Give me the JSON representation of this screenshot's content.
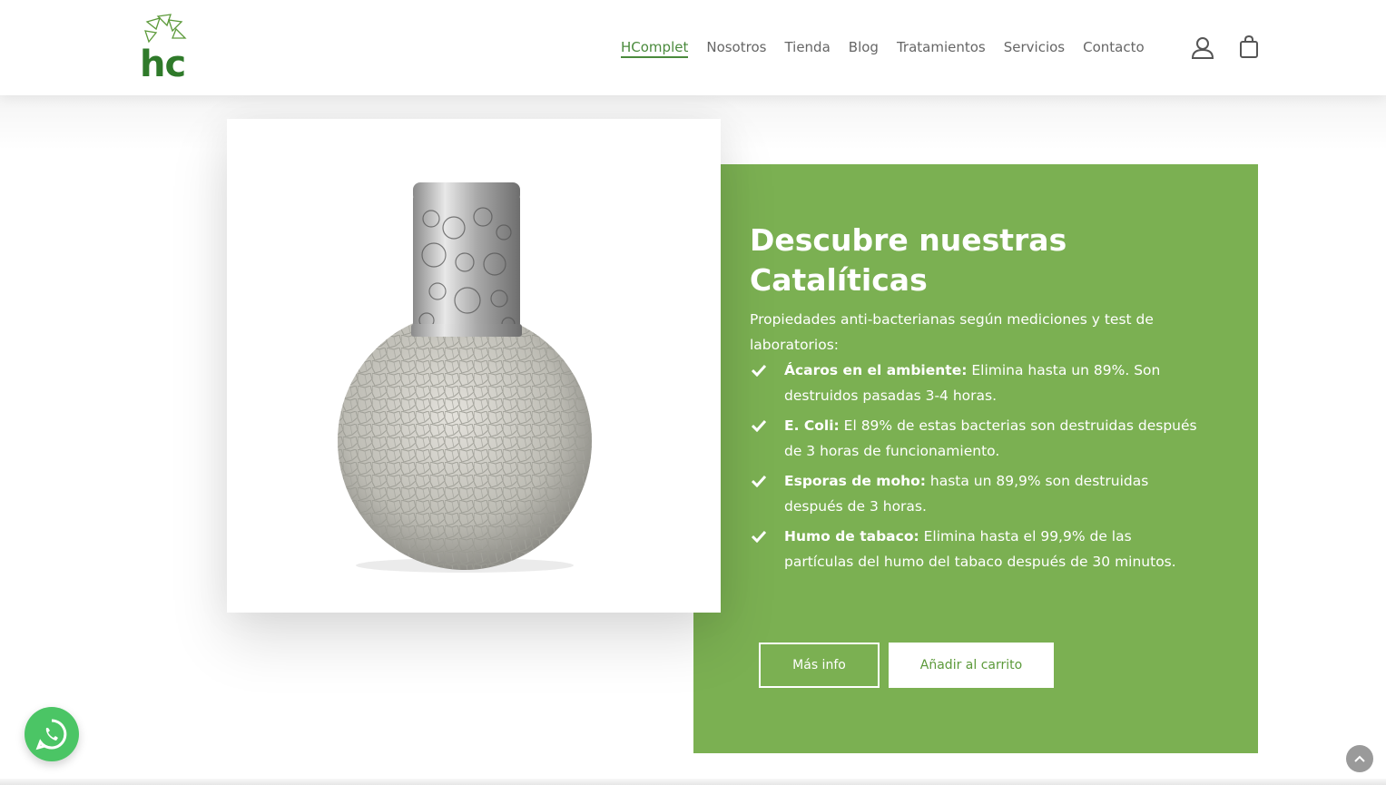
{
  "header": {
    "logo_text": "hc",
    "nav": [
      {
        "label": "HComplet",
        "active": true
      },
      {
        "label": "Nosotros"
      },
      {
        "label": "Tienda"
      },
      {
        "label": "Blog"
      },
      {
        "label": "Tratamientos"
      },
      {
        "label": "Servicios"
      },
      {
        "label": "Contacto"
      }
    ],
    "icons": [
      "user-account-icon",
      "shopping-bag-icon"
    ]
  },
  "product": {
    "image_alt": "lámpara catalítica",
    "title": "Descubre nuestras Catalíticas",
    "intro": "Propiedades anti-bacterianas según mediciones y test de laboratorios:",
    "benefits": [
      {
        "bold": "Ácaros en el ambiente:",
        "text": " Elimina hasta un 89%. Son destruidos pasadas 3-4 horas."
      },
      {
        "bold": "E. Coli:",
        "text": " El 89% de estas bacterias son destruidas después de 3 horas de funcionamiento."
      },
      {
        "bold": "Esporas de moho:",
        "text": " hasta un 89,9% son destruidas después de 3 horas."
      },
      {
        "bold": "Humo de tabaco:",
        "text": " Elimina hasta el 99,9% de las partículas del humo del tabaco después de 30 minutos."
      }
    ],
    "buttons": {
      "more_info": "Más info",
      "add_to_cart": "Añadir al carrito"
    }
  },
  "colors": {
    "brand_green": "#7bb052",
    "nav_active": "#4a8a3c",
    "whatsapp": "#4bc565"
  },
  "floating": {
    "whatsapp_icon": "whatsapp-icon",
    "scroll_top_icon": "chevron-up-icon"
  }
}
